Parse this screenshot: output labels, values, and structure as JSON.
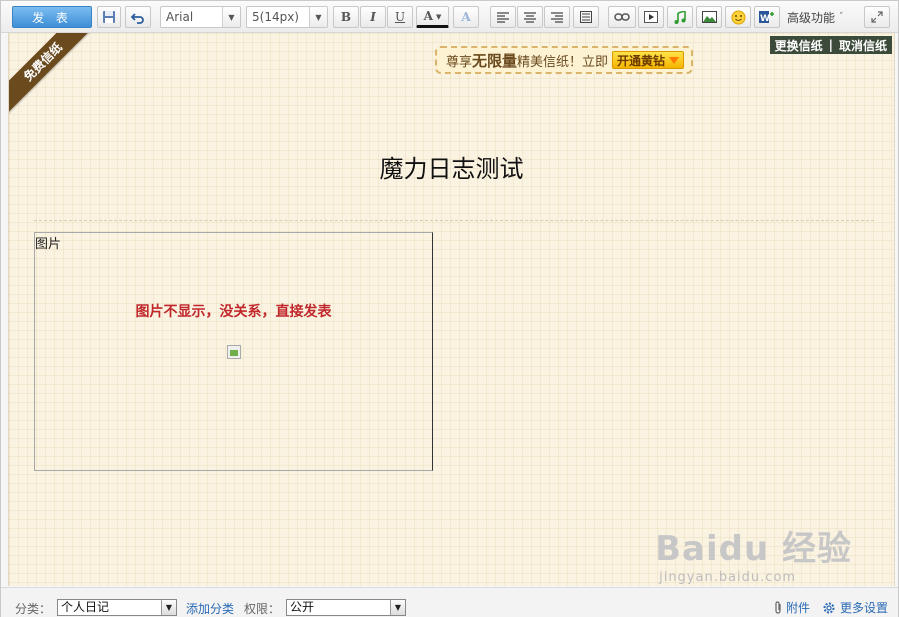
{
  "toolbar": {
    "publish_label": "发 表",
    "font_family": "Arial",
    "font_size": "5(14px)",
    "bold": "B",
    "italic": "I",
    "underline": "U",
    "font_color": "A",
    "font_effect": "A",
    "advanced_label": "高级功能",
    "icons": [
      "save-icon",
      "undo-icon",
      "bold-icon",
      "italic-icon",
      "underline-icon",
      "font-color-icon",
      "text-effect-icon",
      "align-left-icon",
      "align-center-icon",
      "align-right-icon",
      "justify-icon",
      "link-icon",
      "video-icon",
      "music-icon",
      "image-icon",
      "emoticon-icon",
      "word-import-icon",
      "expand-icon"
    ]
  },
  "stationery": {
    "ribbon": "免费信纸",
    "change": "更换信纸",
    "separator": "|",
    "cancel": "取消信纸",
    "promo_prefix": "尊享",
    "promo_big": "无限量",
    "promo_suffix": "精美信纸！立即",
    "promo_button": "开通黄钻"
  },
  "document": {
    "title": "魔力日志测试",
    "image_label": "图片",
    "image_note": "图片不显示，没关系，直接发表"
  },
  "watermark": {
    "brand": "Baidu 经验",
    "url": "jingyan.baidu.com"
  },
  "bottom": {
    "category_label": "分类：",
    "category_value": "个人日记",
    "add_category": "添加分类",
    "permission_label": "权限：",
    "permission_value": "公开",
    "attachment": "附件",
    "more_settings": "更多设置"
  },
  "colors": {
    "publish_blue": "#3d8fd8",
    "paper_bg": "#fbf3e2",
    "note_red": "#c0282b",
    "link_blue": "#2a6ab5",
    "ribbon_brown": "#6b4a1e"
  }
}
